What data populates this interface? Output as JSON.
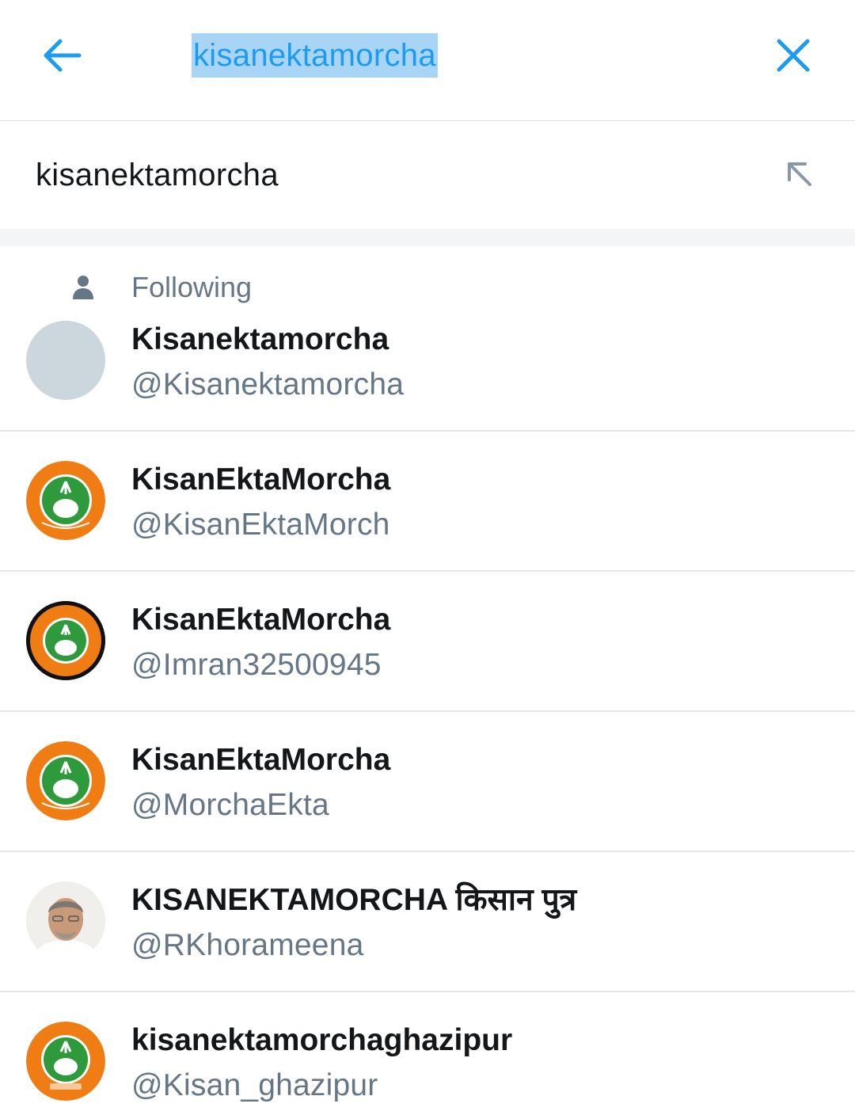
{
  "search": {
    "query": "kisanektamorcha"
  },
  "suggestion": {
    "text": "kisanektamorcha"
  },
  "section": {
    "following_label": "Following"
  },
  "results": [
    {
      "name": "Kisanektamorcha",
      "handle": "@Kisanektamorcha",
      "avatar": "blank"
    },
    {
      "name": "KisanEktaMorcha",
      "handle": "@KisanEktaMorch",
      "avatar": "logo-orange"
    },
    {
      "name": "KisanEktaMorcha",
      "handle": "@Imran32500945",
      "avatar": "logo-orange-black-ring"
    },
    {
      "name": "KisanEktaMorcha",
      "handle": "@MorchaEkta",
      "avatar": "logo-orange"
    },
    {
      "name": "KISANEKTAMORCHA किसान पुत्र",
      "handle": "@RKhorameena",
      "avatar": "photo-man"
    },
    {
      "name": "kisanektamorchaghazipur",
      "handle": "@Kisan_ghazipur",
      "avatar": "logo-orange"
    }
  ],
  "colors": {
    "accent": "#1d9bf0",
    "selection": "#a8d5f6",
    "secondary_text": "#657786",
    "logo_orange": "#f07d14",
    "logo_green": "#2f9a3b"
  }
}
